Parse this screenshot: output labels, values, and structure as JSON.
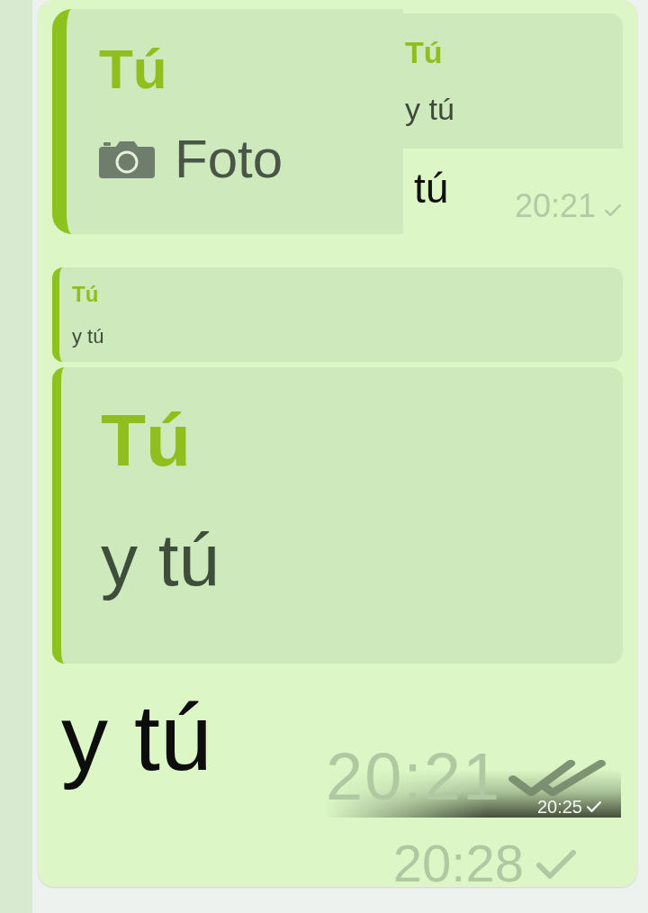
{
  "top_message": {
    "quote": {
      "kind": "photo",
      "sender": "Tú",
      "text": "Foto"
    },
    "inner_quote": {
      "sender": "Tú",
      "text": "y tú"
    },
    "text": "tú",
    "time": "20:21",
    "delivered": false
  },
  "bottom_message": {
    "quotes": [
      {
        "sender": "Tú",
        "text": "y tú"
      },
      {
        "sender": "Tú",
        "text": "y tú"
      }
    ],
    "text": "y tú",
    "time": "20:21",
    "delivered": true,
    "overlay": {
      "time": "20:25",
      "delivered": false
    }
  },
  "footer": {
    "time": "20:28",
    "delivered": false
  }
}
